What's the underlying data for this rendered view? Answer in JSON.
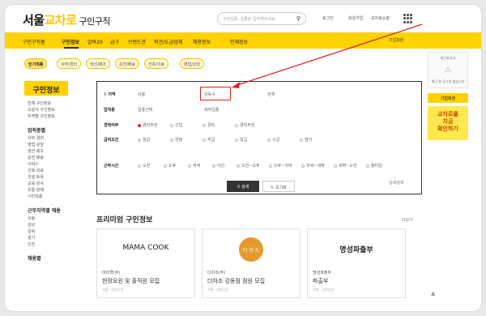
{
  "header": {
    "logo_main": "서울",
    "logo_highlight": "교차로",
    "logo_sub": "구인구직",
    "search_placeholder": "구직업종, 업종을 입력해주세요",
    "menu": [
      "로그인",
      "회원가입",
      "교차로쇼핑"
    ]
  },
  "nav": {
    "items": [
      "구인구직홈",
      "구인정보",
      "알바20",
      "급구",
      "브랜드관",
      "파견/도급업체",
      "채용정보",
      "인재정보"
    ],
    "right": "기업회원"
  },
  "chips": [
    "인기직종",
    "사무/경리",
    "생산/제조",
    "운전/배송",
    "간호/의료",
    "영업/상담"
  ],
  "sidebar": {
    "title": "구인정보",
    "top_items": [
      "전체 구인정보",
      "오늘의 구인정보",
      "지역별 구인정보"
    ],
    "section1": "업직종별",
    "section1_items": [
      "사무·경리",
      "영업·상담",
      "생산·제조",
      "운전·배송",
      "서비스",
      "간호·의료",
      "건설·토목",
      "교육·강사",
      "유통·판매",
      "기타직종"
    ],
    "section2": "근무지역별 채용",
    "section2_items": [
      "서울",
      "강남",
      "강북",
      "경기",
      "인천"
    ],
    "section3": "채용별"
  },
  "filter": {
    "row1_label": "지역",
    "row1_opts": [
      "서울",
      "강동구",
      "전체"
    ],
    "row2_label": "업직종",
    "row2_opts": [
      "업종선택",
      "세부업종"
    ],
    "row3_label": "경력여부",
    "row3_opts": [
      "경력무관",
      "신입",
      "경력",
      "경력무관"
    ],
    "row4_label": "급여조건",
    "row4_opts": [
      "월급",
      "연봉",
      "주급",
      "일급",
      "시급",
      "협의"
    ],
    "row5_label": "근무시간",
    "row5_opts": [
      "오전",
      "오후",
      "저녁",
      "야간",
      "오전~오후",
      "오후~저녁",
      "저녁~새벽",
      "새벽~오전",
      "풀타임"
    ],
    "search_btn": "검색",
    "reset_btn": "초기화",
    "detail_link": "상세검색"
  },
  "premium": {
    "title": "프리미엄 구인정보",
    "more": "더보기",
    "cards": [
      {
        "logo": "MAMA COOK",
        "company": "마마쿡(주)",
        "title": "현장요원 및 홀직원 모집",
        "meta": "서울 · 경력무관"
      },
      {
        "logo": "더 차 조",
        "company": "더차조(주)",
        "title": "더차조 강동점 점원 모집",
        "meta": "서울 · 경력무관"
      },
      {
        "logo": "명성파출부",
        "company": "명성파출부",
        "title": "파출부",
        "meta": "서울 · 경력무관"
      }
    ]
  },
  "right_panel": {
    "box_text": "최근본공고",
    "box_sub": "최근 본 공고가 없습니다",
    "button": "기업회원",
    "ad_line1": "교차로를",
    "ad_line2": "지금",
    "ad_line3": "확인하기"
  },
  "colors": {
    "brand_yellow": "#ffd200",
    "highlight_red": "#e02020"
  }
}
